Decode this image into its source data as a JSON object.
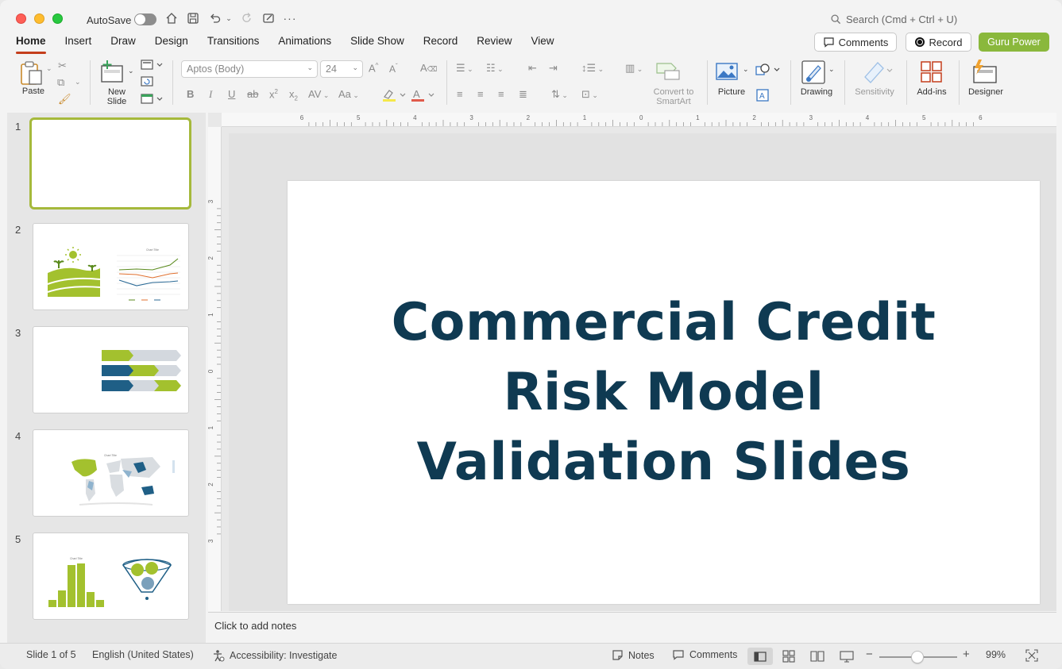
{
  "titlebar": {
    "autosave_label": "AutoSave",
    "search_placeholder": "Search (Cmd + Ctrl + U)"
  },
  "menu": {
    "tabs": [
      "Home",
      "Insert",
      "Draw",
      "Design",
      "Transitions",
      "Animations",
      "Slide Show",
      "Record",
      "Review",
      "View"
    ],
    "comments_label": "Comments",
    "record_label": "Record",
    "guru_label": "Guru Power",
    "guru_color": "#8ab83c"
  },
  "ribbon": {
    "paste": "Paste",
    "new_slide": "New\nSlide",
    "new_slide_l1": "New",
    "new_slide_l2": "Slide",
    "font_name": "Aptos (Body)",
    "font_size": "24",
    "convert_l1": "Convert to",
    "convert_l2": "SmartArt",
    "picture": "Picture",
    "drawing": "Drawing",
    "sensitivity": "Sensitivity",
    "addins": "Add-ins",
    "designer": "Designer"
  },
  "thumbnails": {
    "numbers": [
      "1",
      "2",
      "3",
      "4",
      "5"
    ],
    "thumb2_chart_title": "Chart Title",
    "thumb4_chart_title": "Chart Title",
    "thumb5_chart_title": "Chart Title"
  },
  "slide": {
    "title_line1": "Commercial Credit",
    "title_line2": "Risk Model",
    "title_line3": "Validation Slides",
    "title_color": "#0f3a52"
  },
  "notes": {
    "placeholder": "Click to add notes"
  },
  "ruler": {
    "h_labels": [
      "6",
      "5",
      "4",
      "3",
      "2",
      "1",
      "0",
      "1",
      "2",
      "3",
      "4",
      "5",
      "6"
    ],
    "v_labels": [
      "3",
      "2",
      "1",
      "0",
      "1",
      "2",
      "3"
    ]
  },
  "status": {
    "slide_count": "Slide 1 of 5",
    "language": "English (United States)",
    "accessibility": "Accessibility: Investigate",
    "notes": "Notes",
    "comments": "Comments",
    "zoom": "99%",
    "zoom_minus": "−",
    "zoom_plus": "+"
  }
}
